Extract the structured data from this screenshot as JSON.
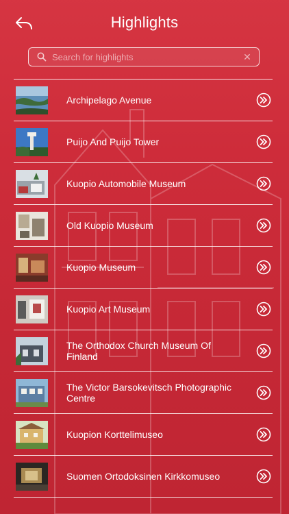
{
  "header": {
    "title": "Highlights",
    "back_icon": "back-reply-icon"
  },
  "search": {
    "placeholder": "Search for highlights",
    "value": "",
    "icon": "search-icon",
    "clear_icon": "clear-icon",
    "clear_glyph": "✕"
  },
  "colors": {
    "background": "#c92f3b",
    "text": "#ffffff",
    "divider": "#ffffff"
  },
  "items": [
    {
      "label": "Archipelago Avenue"
    },
    {
      "label": "Puijo And Puijo Tower"
    },
    {
      "label": "Kuopio Automobile Museum"
    },
    {
      "label": "Old Kuopio Museum"
    },
    {
      "label": "Kuopio Museum"
    },
    {
      "label": "Kuopio Art Museum"
    },
    {
      "label": "The Orthodox Church Museum Of Finland"
    },
    {
      "label": "The Victor Barsokevitsch Photographic Centre"
    },
    {
      "label": "Kuopion Korttelimuseo"
    },
    {
      "label": "Suomen Ortodoksinen Kirkkomuseo"
    }
  ]
}
